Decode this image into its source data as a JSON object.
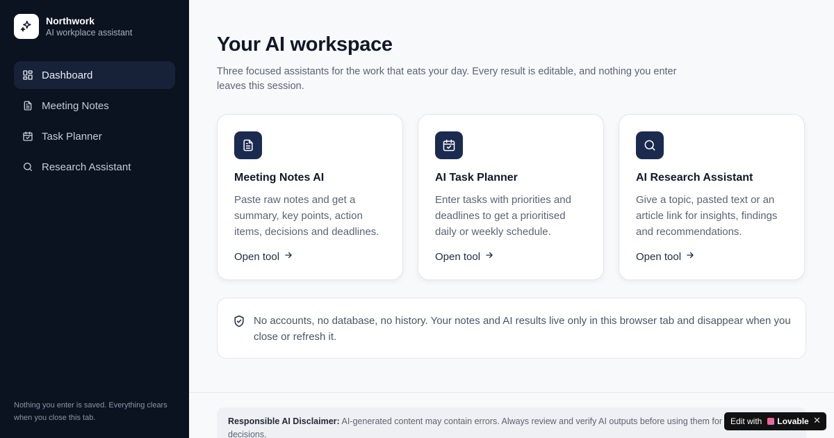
{
  "brand": {
    "name": "Northwork",
    "subtitle": "AI workplace assistant"
  },
  "sidebar": {
    "items": [
      {
        "label": "Dashboard",
        "icon": "grid-icon",
        "active": true
      },
      {
        "label": "Meeting Notes",
        "icon": "document-icon",
        "active": false
      },
      {
        "label": "Task Planner",
        "icon": "calendar-check-icon",
        "active": false
      },
      {
        "label": "Research Assistant",
        "icon": "search-icon",
        "active": false
      }
    ],
    "footer": "Nothing you enter is saved. Everything clears when you close this tab."
  },
  "main": {
    "title": "Your AI workspace",
    "description": "Three focused assistants for the work that eats your day. Every result is editable, and nothing you enter leaves this session.",
    "cards": [
      {
        "title": "Meeting Notes AI",
        "text": "Paste raw notes and get a summary, key points, action items, decisions and deadlines.",
        "link": "Open tool",
        "icon": "document-icon"
      },
      {
        "title": "AI Task Planner",
        "text": "Enter tasks with priorities and deadlines to get a prioritised daily or weekly schedule.",
        "link": "Open tool",
        "icon": "calendar-check-icon"
      },
      {
        "title": "AI Research Assistant",
        "text": "Give a topic, pasted text or an article link for insights, findings and recommendations.",
        "link": "Open tool",
        "icon": "search-icon"
      }
    ],
    "notice": "No accounts, no database, no history. Your notes and AI results live only in this browser tab and disappear when you close or refresh it.",
    "disclaimer": {
      "label": "Responsible AI Disclaimer:",
      "text": "AI-generated content may contain errors. Always review and verify AI outputs before using them for workplace decisions."
    }
  },
  "badge": {
    "prefix": "Edit with",
    "brand": "Lovable",
    "close": "✕"
  },
  "colors": {
    "sidebar_bg": "#0b1220",
    "accent": "#1b2b4f",
    "page_bg": "#f8f9fb"
  }
}
